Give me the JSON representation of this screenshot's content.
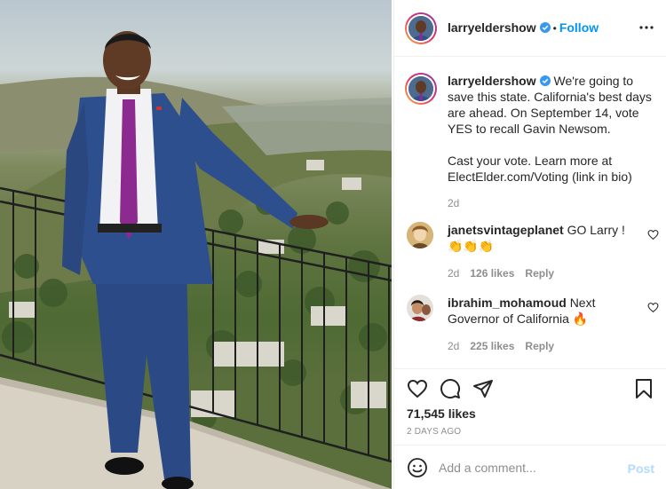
{
  "post": {
    "author": "larryeldershow",
    "follow_label": "Follow",
    "dot": "•",
    "caption": {
      "username": "larryeldershow",
      "line1": "We're going to save this state. California's best days are ahead. On September 14, vote YES to recall Gavin Newsom.",
      "line2": "Cast your vote. Learn more at ElectElder.com/Voting (link in bio)",
      "time": "2d"
    },
    "comments": [
      {
        "username": "janetsvintageplanet",
        "text": "GO Larry ! 👏👏👏",
        "time": "2d",
        "likes": "126 likes",
        "reply": "Reply"
      },
      {
        "username": "ibrahim_mohamoud",
        "text": "Next Governor of California 🔥",
        "time": "2d",
        "likes": "225 likes",
        "reply": "Reply"
      }
    ],
    "likes_count": "71,545 likes",
    "date": "2 DAYS AGO",
    "comment_placeholder": "Add a comment...",
    "post_label": "Post"
  },
  "colors": {
    "link_blue": "#0095f6",
    "post_disabled": "#b3dbff",
    "meta_gray": "#8e8e8e",
    "suit_navy": "#2b4a85",
    "tie_purple": "#8d2a8f"
  },
  "icons": [
    "verified-badge-icon",
    "more-options-icon",
    "heart-icon",
    "comment-icon",
    "share-icon",
    "bookmark-icon",
    "emoji-icon"
  ]
}
